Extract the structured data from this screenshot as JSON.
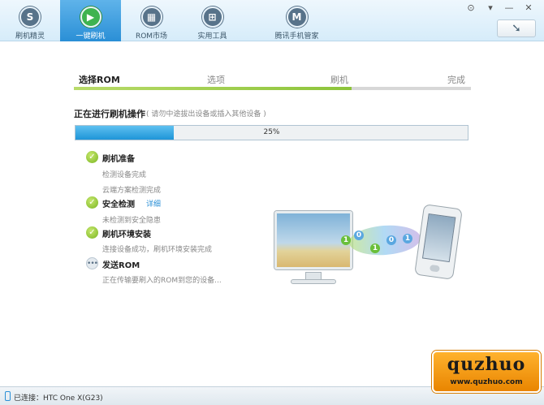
{
  "nav": {
    "items": [
      {
        "label": "刷机精灵",
        "icon": "S"
      },
      {
        "label": "一键刷机",
        "icon": "▶"
      },
      {
        "label": "ROM市场",
        "icon": "▦"
      },
      {
        "label": "实用工具",
        "icon": "⊞"
      },
      {
        "label": "腾讯手机管家",
        "icon": "M"
      }
    ],
    "active": "一键刷机",
    "window_controls": [
      "⊙",
      "▾",
      "—",
      "✕"
    ],
    "back_icon": "➘"
  },
  "steps": {
    "items": [
      "选择ROM",
      "选项",
      "刷机",
      "完成"
    ],
    "current": "选择ROM",
    "progress": 0.7
  },
  "operation": {
    "title": "正在进行刷机操作",
    "note": "( 请勿中途拔出设备或插入其他设备 )"
  },
  "progress": {
    "percent": 25,
    "text": "25%"
  },
  "tasks": [
    {
      "title": "刷机准备",
      "status": "done",
      "details": [
        "检测设备完成",
        "云端方案检测完成"
      ]
    },
    {
      "title": "安全检测",
      "status": "done",
      "link": "详细",
      "details": [
        "未检测到安全隐患"
      ]
    },
    {
      "title": "刷机环境安装",
      "status": "done",
      "details": [
        "连接设备成功，刷机环境安装完成"
      ]
    },
    {
      "title": "发送ROM",
      "status": "in-progress",
      "details": [
        "正在传输要刷入的ROM到您的设备..."
      ]
    }
  ],
  "illustration": {
    "bits": [
      "1",
      "0",
      "1",
      "0",
      "1"
    ]
  },
  "status": {
    "text": "已连接：HTC One X(G23)"
  },
  "watermark": {
    "big": "quzhuo",
    "small": "www.quzhuo.com"
  },
  "colors": {
    "accent_blue": "#2a8fd6",
    "success_green": "#79b521",
    "step_green": "#8cc43a",
    "watermark_orange": "#f19a12"
  }
}
